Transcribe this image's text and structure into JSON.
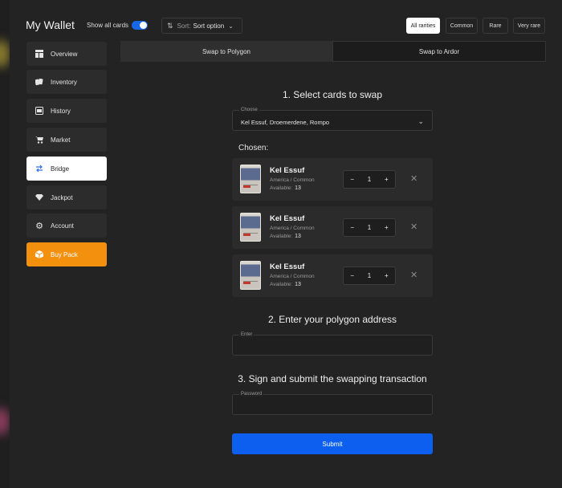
{
  "header": {
    "title": "My Wallet",
    "show_all_label": "Show all cards",
    "sort_label": "Sort:",
    "sort_value": "Sort option",
    "rarities": [
      "All rarities",
      "Common",
      "Rare",
      "Very rare"
    ]
  },
  "sidebar": {
    "items": [
      {
        "label": "Overview",
        "icon": "overview-icon"
      },
      {
        "label": "Inventory",
        "icon": "cards-icon"
      },
      {
        "label": "History",
        "icon": "history-icon"
      },
      {
        "label": "Market",
        "icon": "cart-icon"
      },
      {
        "label": "Bridge",
        "icon": "swap-arrows-icon"
      },
      {
        "label": "Jackpot",
        "icon": "diamond-icon"
      },
      {
        "label": "Account",
        "icon": "gear-icon"
      },
      {
        "label": "Buy Pack",
        "icon": "pack-icon"
      }
    ]
  },
  "tabs": [
    "Swap to Polygon",
    "Swap to Ardor"
  ],
  "step1": {
    "heading": "1. Select cards to swap",
    "choose_legend": "Choose",
    "choose_value": "Kel Essuf, Droemerdene, Rompo",
    "chosen_label": "Chosen:"
  },
  "cards": [
    {
      "name": "Kel Essuf",
      "region": "America",
      "sep": "/",
      "rarity": "Common",
      "available_label": "Available:",
      "available": "13",
      "qty": "1"
    },
    {
      "name": "Kel Essuf",
      "region": "America",
      "sep": "/",
      "rarity": "Common",
      "available_label": "Available:",
      "available": "13",
      "qty": "1"
    },
    {
      "name": "Kel Essuf",
      "region": "America",
      "sep": "/",
      "rarity": "Common",
      "available_label": "Available:",
      "available": "13",
      "qty": "1"
    }
  ],
  "stepper": {
    "minus": "−",
    "plus": "+"
  },
  "remove_glyph": "✕",
  "step2": {
    "heading": "2. Enter your polygon address",
    "legend": "Enter"
  },
  "step3": {
    "heading": "3. Sign and submit the swapping transaction",
    "legend": "Password"
  },
  "submit_label": "Submit",
  "colors": {
    "accent": "#0d5ff0",
    "buy_pack": "#f3900e",
    "toggle": "#1668e8"
  }
}
